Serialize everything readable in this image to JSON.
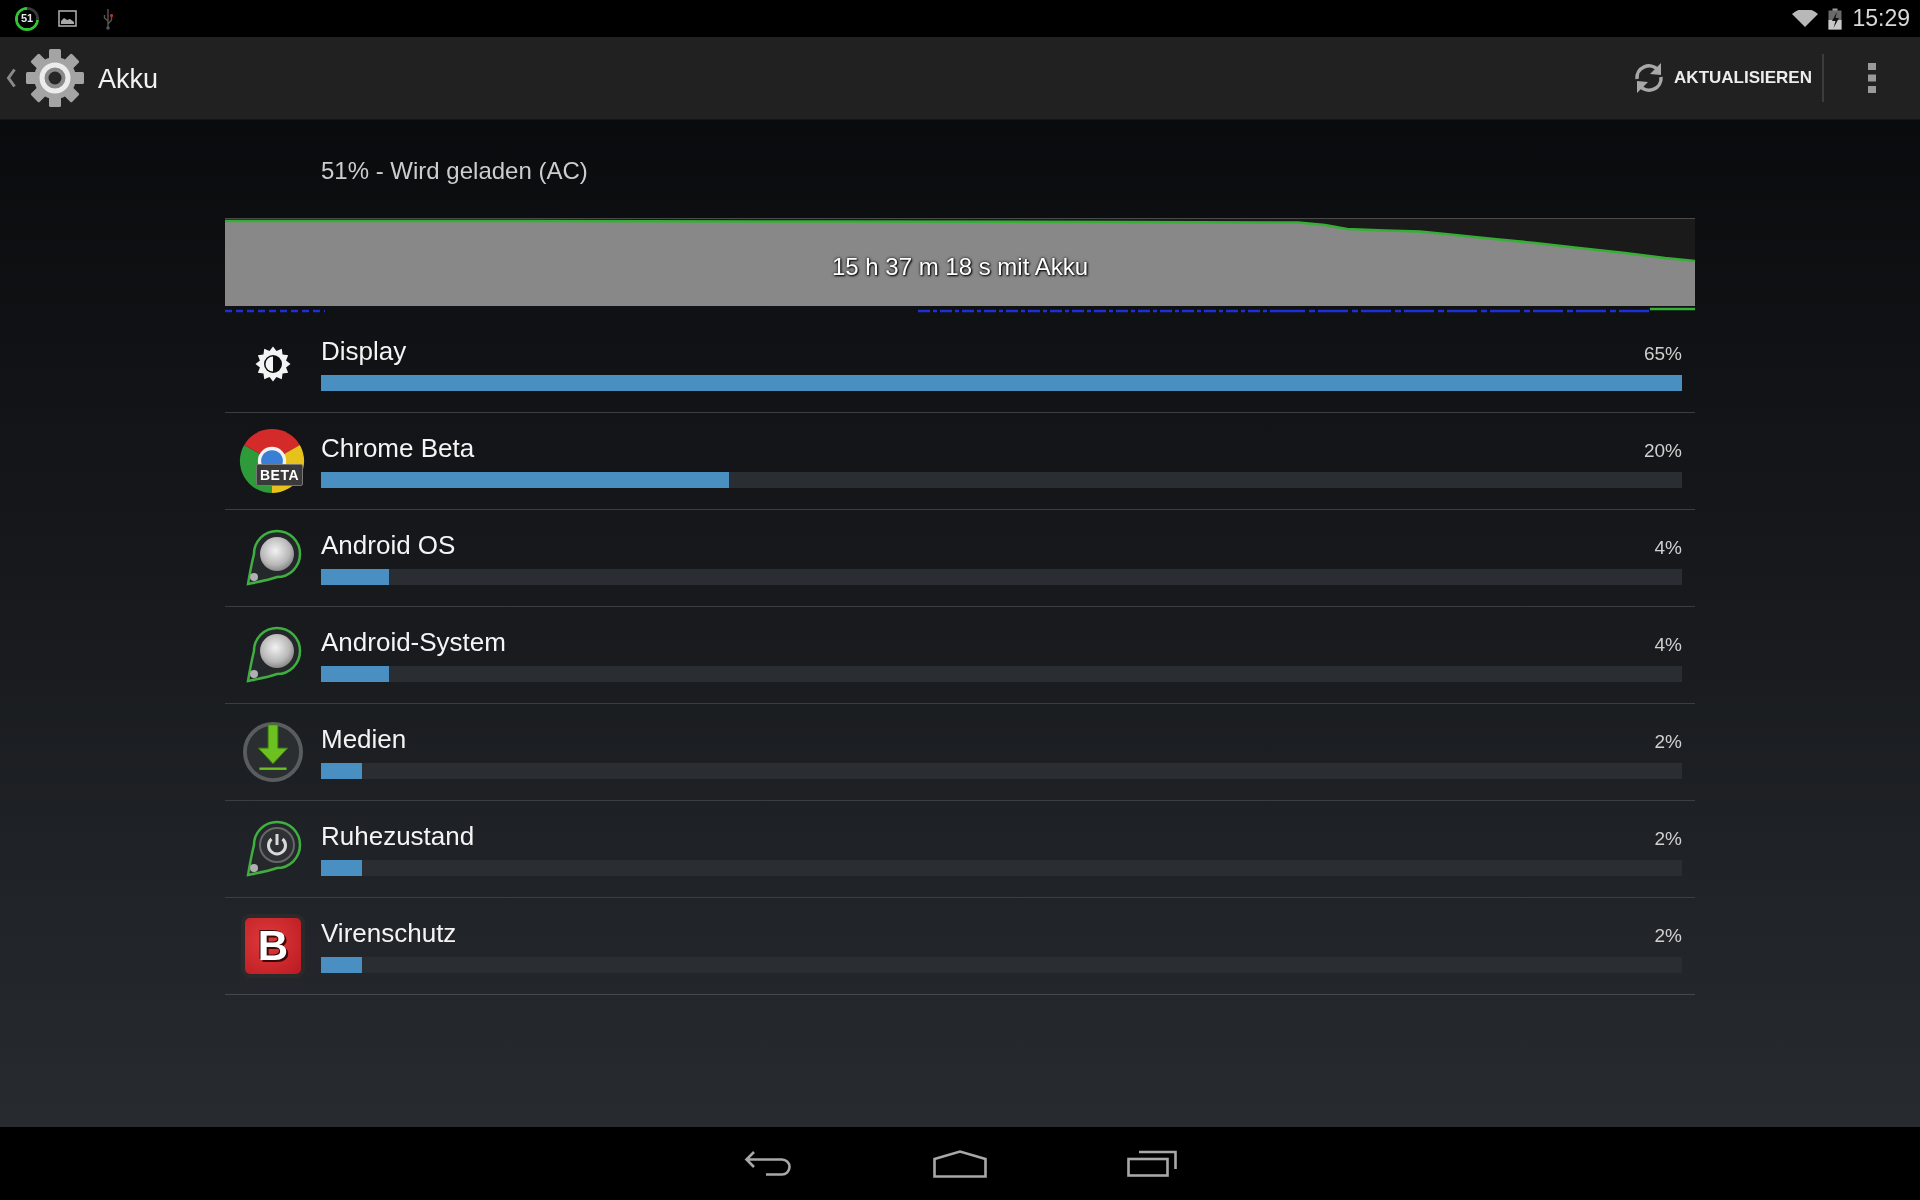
{
  "status_bar": {
    "battery_badge": "51",
    "time": "15:29"
  },
  "action_bar": {
    "title": "Akku",
    "action": "AKTUALISIEREN"
  },
  "summary": {
    "status": "51% - Wird geladen (AC)",
    "graph_label": "15 h 37 m 18 s mit Akku"
  },
  "apps": [
    {
      "kind": "display",
      "name": "Display",
      "percent": "65%",
      "level": 1
    },
    {
      "kind": "chrome",
      "name": "Chrome Beta",
      "icon_label": "BETA",
      "percent": "20%",
      "level": 0.3
    },
    {
      "kind": "android",
      "name": "Android OS",
      "percent": "4%",
      "level": 0.05
    },
    {
      "kind": "android",
      "name": "Android-System",
      "percent": "4%",
      "level": 0.05
    },
    {
      "kind": "media",
      "name": "Medien",
      "percent": "2%",
      "level": 0.03
    },
    {
      "kind": "sleep",
      "name": "Ruhezustand",
      "percent": "2%",
      "level": 0.03
    },
    {
      "kind": "antivirus",
      "name": "Virenschutz",
      "icon_label": "B",
      "percent": "2%",
      "level": 0.03
    }
  ]
}
